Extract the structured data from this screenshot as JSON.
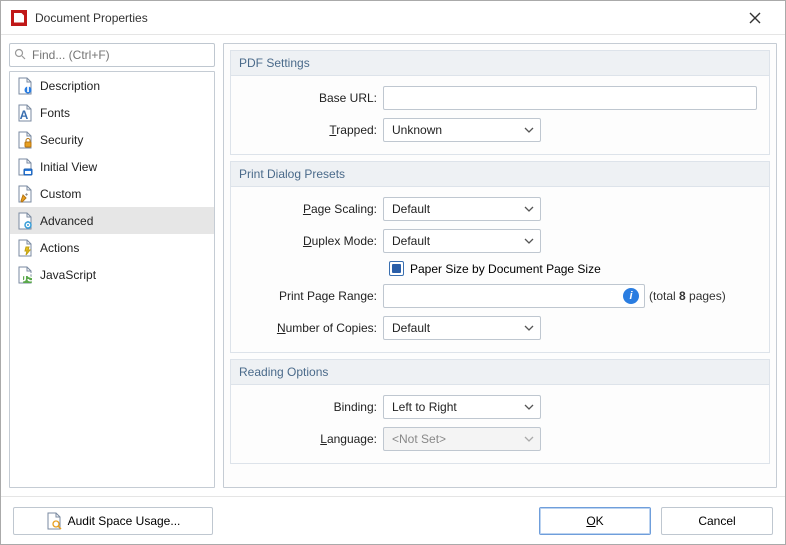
{
  "window": {
    "title": "Document Properties"
  },
  "search": {
    "placeholder": "Find... (Ctrl+F)"
  },
  "nav": {
    "items": [
      {
        "label": "Description"
      },
      {
        "label": "Fonts"
      },
      {
        "label": "Security"
      },
      {
        "label": "Initial View"
      },
      {
        "label": "Custom"
      },
      {
        "label": "Advanced"
      },
      {
        "label": "Actions"
      },
      {
        "label": "JavaScript"
      }
    ],
    "selected_index": 5
  },
  "groups": {
    "pdf_settings": {
      "title": "PDF Settings",
      "base_url": {
        "label": "Base URL:",
        "value": ""
      },
      "trapped": {
        "label": "Trapped:",
        "value": "Unknown",
        "accel": "T"
      }
    },
    "print_presets": {
      "title": "Print Dialog Presets",
      "page_scaling": {
        "label": "Page Scaling:",
        "value": "Default",
        "accel": "P"
      },
      "duplex_mode": {
        "label": "Duplex Mode:",
        "value": "Default",
        "accel": "D"
      },
      "paper_size_check": {
        "label": "Paper Size by Document Page Size",
        "checked": true
      },
      "print_range": {
        "label": "Print Page Range:",
        "value": "",
        "hint_prefix": "(total ",
        "hint_count": "8",
        "hint_suffix": " pages)"
      },
      "copies": {
        "label": "Number of Copies:",
        "value": "Default",
        "accel": "N"
      }
    },
    "reading": {
      "title": "Reading Options",
      "binding": {
        "label": "Binding:",
        "value": "Left to Right"
      },
      "language": {
        "label": "Language:",
        "value": "<Not Set>",
        "accel": "L"
      }
    }
  },
  "footer": {
    "audit": "Audit Space Usage...",
    "ok": "OK",
    "cancel": "Cancel"
  }
}
